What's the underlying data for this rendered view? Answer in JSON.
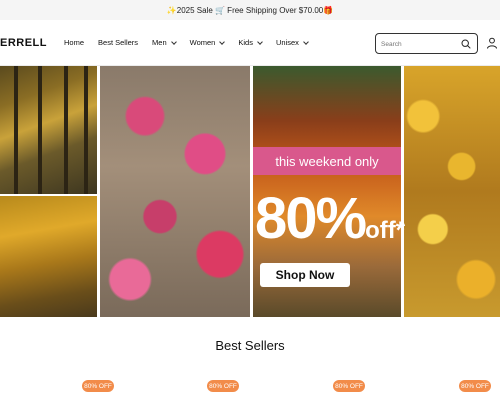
{
  "promo": {
    "text": "✨2025 Sale 🛒 Free Shipping Over $70.00🎁"
  },
  "header": {
    "logo": "ERRELL",
    "nav": [
      "Home",
      "Best Sellers",
      "Men",
      "Women",
      "Kids",
      "Unisex"
    ],
    "search_placeholder": "Search"
  },
  "hero": {
    "banner_text": "this weekend only",
    "sale_number": "80%",
    "sale_suffix": "off*",
    "cta_label": "Shop Now"
  },
  "best_sellers": {
    "title": "Best Sellers",
    "badges": [
      "80% OFF",
      "80% OFF",
      "80% OFF",
      "80% OFF"
    ]
  },
  "colors": {
    "banner_pink": "#d9588c",
    "badge_orange": "#f28c4a"
  }
}
